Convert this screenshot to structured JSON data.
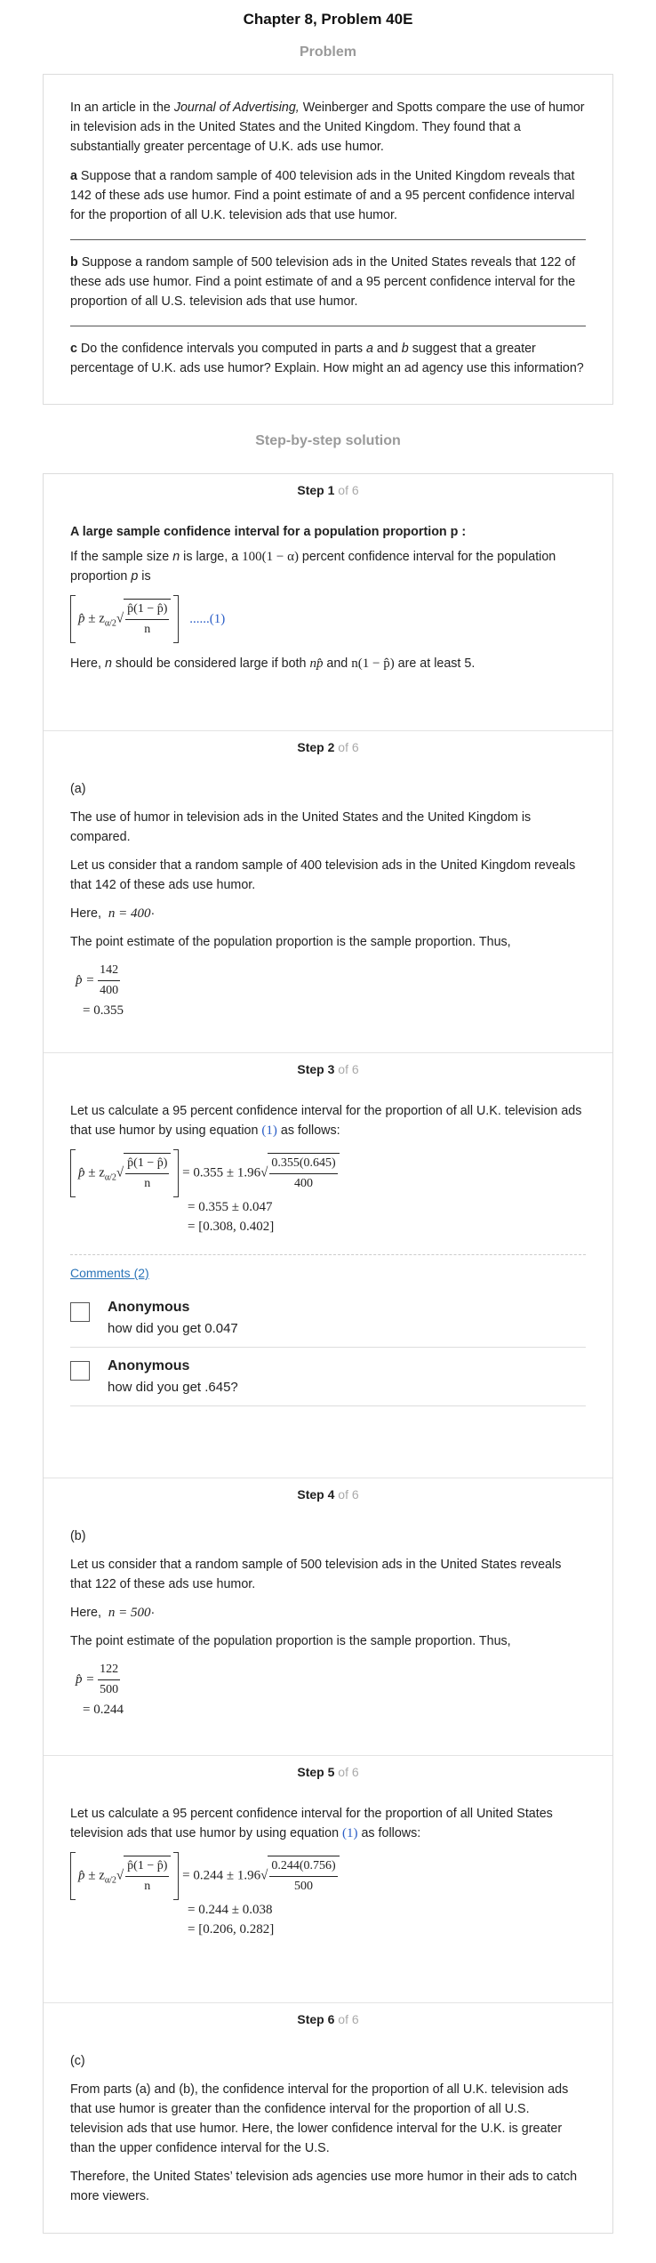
{
  "header": {
    "title": "Chapter 8, Problem 40E"
  },
  "problem": {
    "section_title": "Problem",
    "intro_pre": "In an article in the ",
    "intro_journal": "Journal of Advertising,",
    "intro_post": " Weinberger and Spotts compare the use of humor in television ads in the United States and the United Kingdom. They found that a substantially greater percentage of U.K. ads use humor.",
    "part_a_label": "a",
    "part_a_text": " Suppose that a random sample of 400 television ads in the United Kingdom reveals that 142 of these ads use humor. Find a point estimate of and a 95 percent confidence interval for the proportion of all U.K. television ads that use humor.",
    "part_b_label": "b",
    "part_b_text": " Suppose a random sample of 500 television ads in the United States reveals that 122 of these ads use humor. Find a point estimate of and a 95 percent confidence interval for the proportion of all U.S. television ads that use humor.",
    "part_c_label": "c",
    "part_c_text_1": " Do the confidence intervals you computed in parts ",
    "part_c_a": "a",
    "part_c_and": " and ",
    "part_c_b": "b",
    "part_c_text_2": " suggest that a greater percentage of U.K. ads use humor? Explain. How might an ad agency use this information?"
  },
  "solution": {
    "section_title": "Step-by-step solution",
    "step_word": "Step",
    "of_total": "of 6",
    "steps": [
      {
        "number": "1",
        "heading": "A large sample confidence interval for a population proportion p :",
        "text1_pre": "If the sample size ",
        "text1_n": "n",
        "text1_mid": " is large, a ",
        "text1_expr": "100(1 − α)",
        "text1_post": " percent confidence interval for the population proportion ",
        "text1_p": "p",
        "text1_end": " is",
        "eq_label": "......(1)",
        "text2_pre": "Here, ",
        "text2_n": "n",
        "text2_mid": " should be considered large if both ",
        "text2_expr1": "np̂",
        "text2_and": " and ",
        "text2_expr2": "n(1 − p̂)",
        "text2_post": " are at least 5."
      },
      {
        "number": "2",
        "part": "(a)",
        "p1": "The use of humor in television ads in the United States and the United Kingdom is compared.",
        "p2": "Let us consider that a random sample of 400 television ads in the United Kingdom reveals that 142 of these ads use humor.",
        "here": "Here,",
        "n_expr": "n = 400",
        "p3": "The point estimate of the population proportion is the sample proportion. Thus,",
        "num": "142",
        "den": "400",
        "result": "= 0.355"
      },
      {
        "number": "3",
        "p1_pre": "Let us calculate a 95 percent confidence interval for the proportion of all U.K. television ads that use humor by using equation ",
        "p1_ref": "(1)",
        "p1_post": " as follows:",
        "rhs1_pre": "= 0.355 ± 1.96",
        "rhs1_num": "0.355(0.645)",
        "rhs1_den": "400",
        "line2": "= 0.355 ± 0.047",
        "line3": "= [0.308, 0.402]",
        "comments_link": "Comments (2)",
        "comments": [
          {
            "name": "Anonymous",
            "text": "how did you get 0.047"
          },
          {
            "name": "Anonymous",
            "text": "how did you get .645?"
          }
        ]
      },
      {
        "number": "4",
        "part": "(b)",
        "p1": "Let us consider that a random sample of 500 television ads in the United States reveals that 122 of these ads use humor.",
        "here": "Here,",
        "n_expr": "n = 500",
        "p2": "The point estimate of the population proportion is the sample proportion. Thus,",
        "num": "122",
        "den": "500",
        "result": "= 0.244"
      },
      {
        "number": "5",
        "p1_pre": "Let us calculate a 95 percent confidence interval for the proportion of all United States television ads that use humor by using equation ",
        "p1_ref": "(1)",
        "p1_post": " as follows:",
        "rhs1_pre": "= 0.244 ± 1.96",
        "rhs1_num": "0.244(0.756)",
        "rhs1_den": "500",
        "line2": "= 0.244 ± 0.038",
        "line3": "= [0.206, 0.282]"
      },
      {
        "number": "6",
        "part": "(c)",
        "p1": "From parts (a) and (b), the confidence interval for the proportion of all U.K. television ads that use humor is greater than the confidence interval for the proportion of all U.S. television ads that use humor. Here, the lower confidence interval for the U.K. is greater than the upper confidence interval for the U.S.",
        "p2": "Therefore, the United States’ television ads agencies use more humor in their ads to catch more viewers."
      }
    ]
  },
  "formula": {
    "p_hat": "p̂",
    "pm_z": " ± z",
    "alpha_sub": "α/2",
    "ci_num": "p̂(1 − p̂)",
    "ci_den": "n",
    "p_hat_eq": "p̂ ="
  }
}
